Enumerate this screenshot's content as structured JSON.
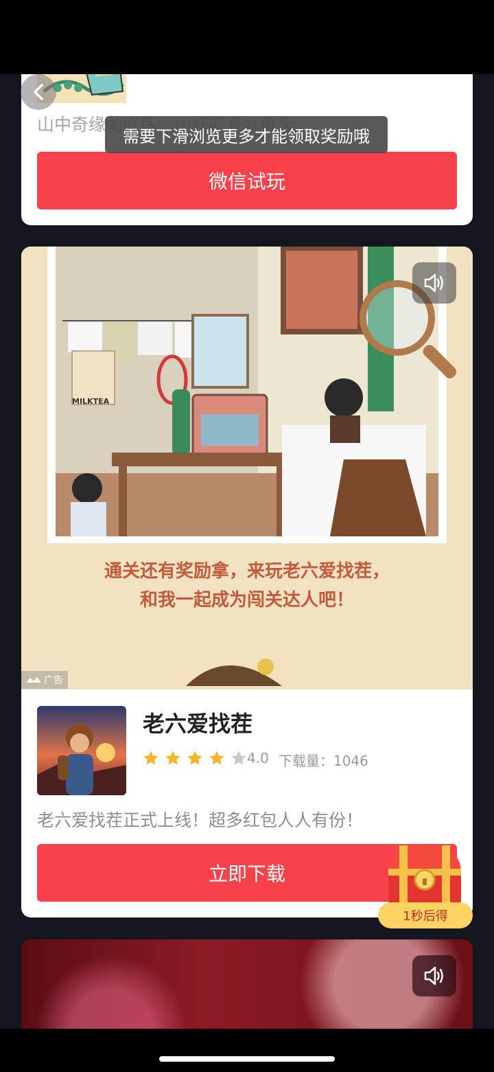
{
  "card1": {
    "description": "山中奇缘助修炼，小妖能登九重天",
    "button_label": "微信试玩"
  },
  "toast": {
    "text": "需要下滑浏览更多才能领取奖励哦"
  },
  "card2": {
    "ad_headline_line1": "通关还有奖励拿，来玩老六爱找茬，",
    "ad_headline_line2": "和我一起成为闯关达人吧！",
    "ad_tag": "广告",
    "poster_label": "MILKTEA",
    "app_name": "老六爱找茬",
    "rating": "4.0",
    "rating_value": 4,
    "rating_max": 5,
    "downloads_label": "下载量：",
    "downloads_count": "1046",
    "description": "老六爱找茬正式上线！超多红包人人有份！",
    "button_label": "立即下载"
  },
  "reward": {
    "countdown": "1秒后得"
  },
  "colors": {
    "accent_red": "#f8414b",
    "star": "#f8b52a",
    "badge": "#ffd462"
  }
}
